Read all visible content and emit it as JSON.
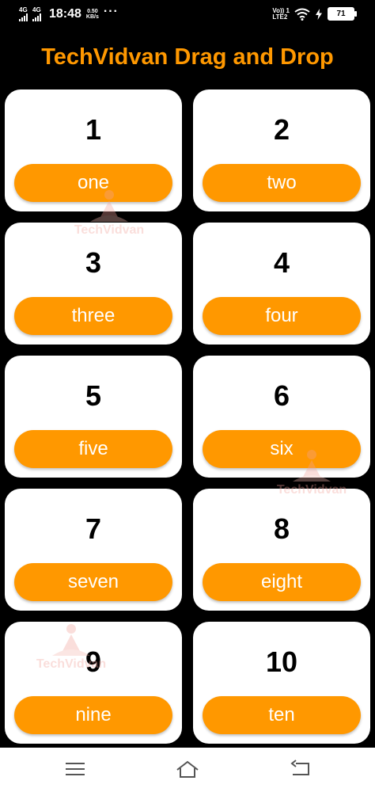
{
  "status_bar": {
    "network1": "4G",
    "network2": "4G",
    "time": "18:48",
    "speed_value": "0.50",
    "speed_unit": "KB/s",
    "more": "···",
    "volte_top": "Vo)) 1",
    "volte_bottom": "LTE2",
    "battery": "71"
  },
  "title": "TechVidvan Drag and Drop",
  "cards": [
    {
      "number": "1",
      "word": "one"
    },
    {
      "number": "2",
      "word": "two"
    },
    {
      "number": "3",
      "word": "three"
    },
    {
      "number": "4",
      "word": "four"
    },
    {
      "number": "5",
      "word": "five"
    },
    {
      "number": "6",
      "word": "six"
    },
    {
      "number": "7",
      "word": "seven"
    },
    {
      "number": "8",
      "word": "eight"
    },
    {
      "number": "9",
      "word": "nine"
    },
    {
      "number": "10",
      "word": "ten"
    }
  ],
  "watermark_text": "TechVidvan",
  "colors": {
    "accent": "#ff9800",
    "background": "#000000",
    "card": "#ffffff"
  },
  "nav_bar": {
    "icons": [
      "menu-icon",
      "home-icon",
      "back-icon"
    ]
  }
}
